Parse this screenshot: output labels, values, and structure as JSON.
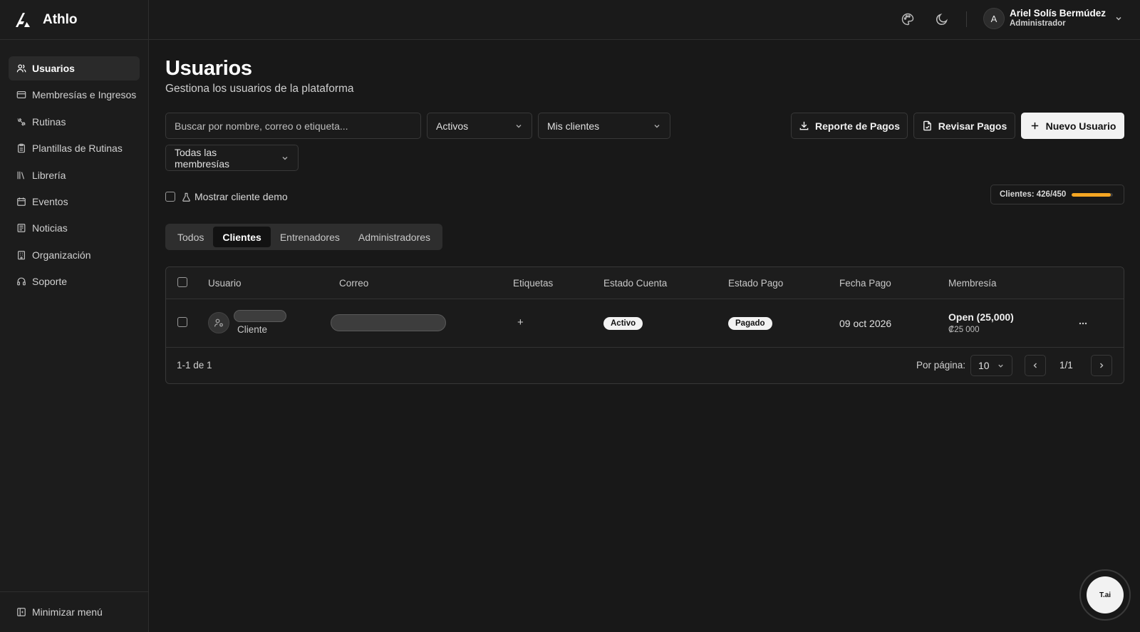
{
  "app": {
    "name": "Athlo"
  },
  "sidebar": {
    "items": [
      {
        "label": "Usuarios",
        "icon": "users-icon",
        "active": true
      },
      {
        "label": "Membresías e Ingresos",
        "icon": "credit-card-icon"
      },
      {
        "label": "Rutinas",
        "icon": "dumbbell-icon"
      },
      {
        "label": "Plantillas de Rutinas",
        "icon": "clipboard-icon"
      },
      {
        "label": "Librería",
        "icon": "library-icon"
      },
      {
        "label": "Eventos",
        "icon": "calendar-icon"
      },
      {
        "label": "Noticias",
        "icon": "newspaper-icon"
      },
      {
        "label": "Organización",
        "icon": "building-icon"
      },
      {
        "label": "Soporte",
        "icon": "headset-icon"
      }
    ],
    "collapse_label": "Minimizar menú"
  },
  "header": {
    "icons": [
      "palette-icon",
      "moon-icon"
    ],
    "user": {
      "initial": "A",
      "name": "Ariel Solís Bermúdez",
      "role": "Administrador"
    }
  },
  "page": {
    "title": "Usuarios",
    "subtitle": "Gestiona los usuarios de la plataforma"
  },
  "filters": {
    "search_placeholder": "Buscar por nombre, correo o etiqueta...",
    "status": "Activos",
    "scope": "Mis clientes",
    "membership": "Todas las membresías"
  },
  "actions": {
    "payments_report": "Reporte de Pagos",
    "review_payments": "Revisar Pagos",
    "new_user": "Nuevo Usuario"
  },
  "demo": {
    "label": "Mostrar cliente demo",
    "checked": false
  },
  "quota": {
    "label": "Clientes: 426/450",
    "used": 426,
    "total": 450,
    "bar_color": "#f5a623"
  },
  "tabs": [
    {
      "label": "Todos",
      "active": false
    },
    {
      "label": "Clientes",
      "active": true
    },
    {
      "label": "Entrenadores",
      "active": false
    },
    {
      "label": "Administradores",
      "active": false
    }
  ],
  "table": {
    "columns": [
      "Usuario",
      "Correo",
      "Etiquetas",
      "Estado Cuenta",
      "Estado Pago",
      "Fecha Pago",
      "Membresía"
    ],
    "rows": [
      {
        "role": "Cliente",
        "tags_add": "+",
        "account_status": "Activo",
        "payment_status": "Pagado",
        "payment_date": "09 oct 2026",
        "membership_name": "Open (25,000)",
        "membership_price": "₡25 000"
      }
    ],
    "footer": {
      "range": "1-1 de 1",
      "per_page_label": "Por página:",
      "per_page": "10",
      "page": "1/1"
    }
  },
  "assistant": {
    "label": "T.ai"
  }
}
